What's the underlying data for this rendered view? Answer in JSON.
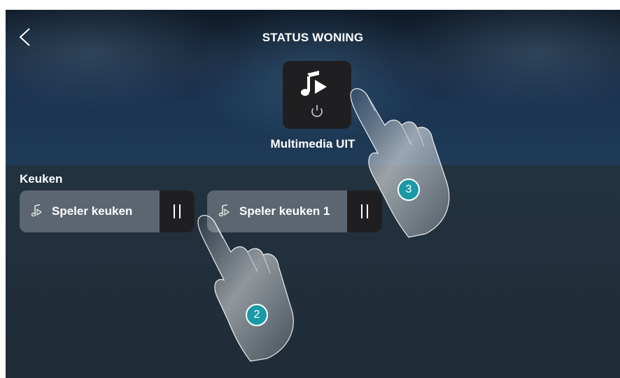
{
  "header": {
    "title": "STATUS WONING",
    "back_icon": "chevron-left-icon"
  },
  "featured": {
    "label": "Multimedia UIT",
    "icons": [
      "music-play-icon",
      "power-icon"
    ]
  },
  "section": {
    "title": "Keuken",
    "players": [
      {
        "label": "Speler keuken",
        "state": "playing"
      },
      {
        "label": "Speler keuken 1",
        "state": "playing"
      }
    ]
  },
  "annotations": {
    "step_2": "2",
    "step_3": "3",
    "accent_color": "#1a9aa6"
  }
}
